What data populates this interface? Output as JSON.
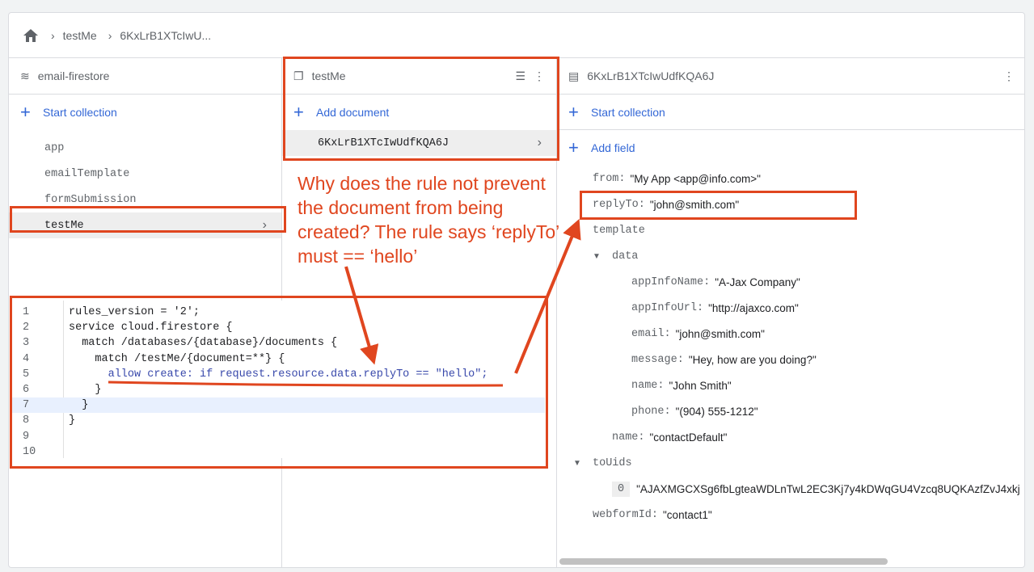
{
  "breadcrumb": {
    "home_icon": "home-icon",
    "items": [
      "testMe",
      "6KxLrB1XTcIwU..."
    ]
  },
  "col1": {
    "title": "email-firestore",
    "action": "Start collection",
    "items": [
      "app",
      "emailTemplate",
      "formSubmission",
      "testMe"
    ],
    "selected": "testMe"
  },
  "col2": {
    "title": "testMe",
    "action": "Add document",
    "items": [
      "6KxLrB1XTcIwUdfKQA6J"
    ]
  },
  "col3": {
    "title": "6KxLrB1XTcIwUdfKQA6J",
    "action1": "Start collection",
    "action2": "Add field",
    "fields": {
      "from": {
        "k": "from:",
        "v": "\"My App <app@info.com>\""
      },
      "replyTo": {
        "k": "replyTo:",
        "v": "\"john@smith.com\""
      },
      "template": {
        "k": "template"
      },
      "data": {
        "k": "data"
      },
      "appInfoName": {
        "k": "appInfoName:",
        "v": "\"A-Jax Company\""
      },
      "appInfoUrl": {
        "k": "appInfoUrl:",
        "v": "\"http://ajaxco.com\""
      },
      "email": {
        "k": "email:",
        "v": "\"john@smith.com\""
      },
      "message": {
        "k": "message:",
        "v": "\"Hey, how are you doing?\""
      },
      "name": {
        "k": "name:",
        "v": "\"John Smith\""
      },
      "phone": {
        "k": "phone:",
        "v": "\"(904) 555-1212\""
      },
      "tname": {
        "k": "name:",
        "v": "\"contactDefault\""
      },
      "toUids": {
        "k": "toUids"
      },
      "uid0": {
        "k": "0",
        "v": "\"AJAXMGCXSg6fbLgteaWDLnTwL2EC3Kj7y4kDWqGU4Vzcq8UQKAzfZvJ4xkj"
      },
      "webformId": {
        "k": "webformId:",
        "v": "\"contact1\""
      }
    }
  },
  "code": {
    "lines": [
      "rules_version = '2';",
      "service cloud.firestore {",
      "  match /databases/{database}/documents {",
      "    match /testMe/{document=**} {",
      "      allow create: if request.resource.data.replyTo == \"hello\";",
      "    }",
      "  }",
      "}",
      "",
      ""
    ]
  },
  "annotation": {
    "text": "Why does the rule not prevent the document from being created?  The rule says ‘replyTo’ must == ‘hello’",
    "color": "#e0461f"
  }
}
